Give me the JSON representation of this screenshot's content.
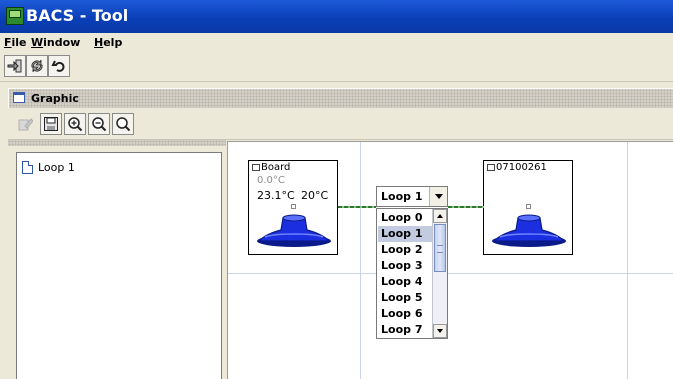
{
  "window": {
    "title": "BACS - Tool"
  },
  "menu": {
    "items": [
      {
        "mnemonic": "F",
        "rest": "ile"
      },
      {
        "mnemonic": "W",
        "rest": "indow"
      },
      {
        "mnemonic": "H",
        "rest": "elp"
      }
    ]
  },
  "toolbar": {
    "icons": [
      "login-icon",
      "refresh-icon",
      "undo-icon"
    ]
  },
  "graphic_panel": {
    "title": "Graphic",
    "toolbar_icons": [
      "edit-icon-disabled",
      "save-icon",
      "zoom-in-icon",
      "zoom-out-icon",
      "zoom-reset-icon"
    ]
  },
  "tree": {
    "items": [
      {
        "label": "Loop 1"
      }
    ]
  },
  "canvas": {
    "devices": [
      {
        "name": "Board",
        "temp0": "0.0°C",
        "temp1": "23.1°C",
        "temp2": "20°C"
      },
      {
        "name": "07100261"
      }
    ],
    "loop_select": {
      "value": "Loop 1",
      "options": [
        "Loop 0",
        "Loop 1",
        "Loop 2",
        "Loop 3",
        "Loop 4",
        "Loop 5",
        "Loop 6",
        "Loop 7"
      ],
      "selected_index": 1
    }
  },
  "colors": {
    "titlebar": "#0a3fb8",
    "thermostat": "#1c2fe0",
    "selection": "#c2cbe0",
    "connector": "#2b7a2b"
  }
}
